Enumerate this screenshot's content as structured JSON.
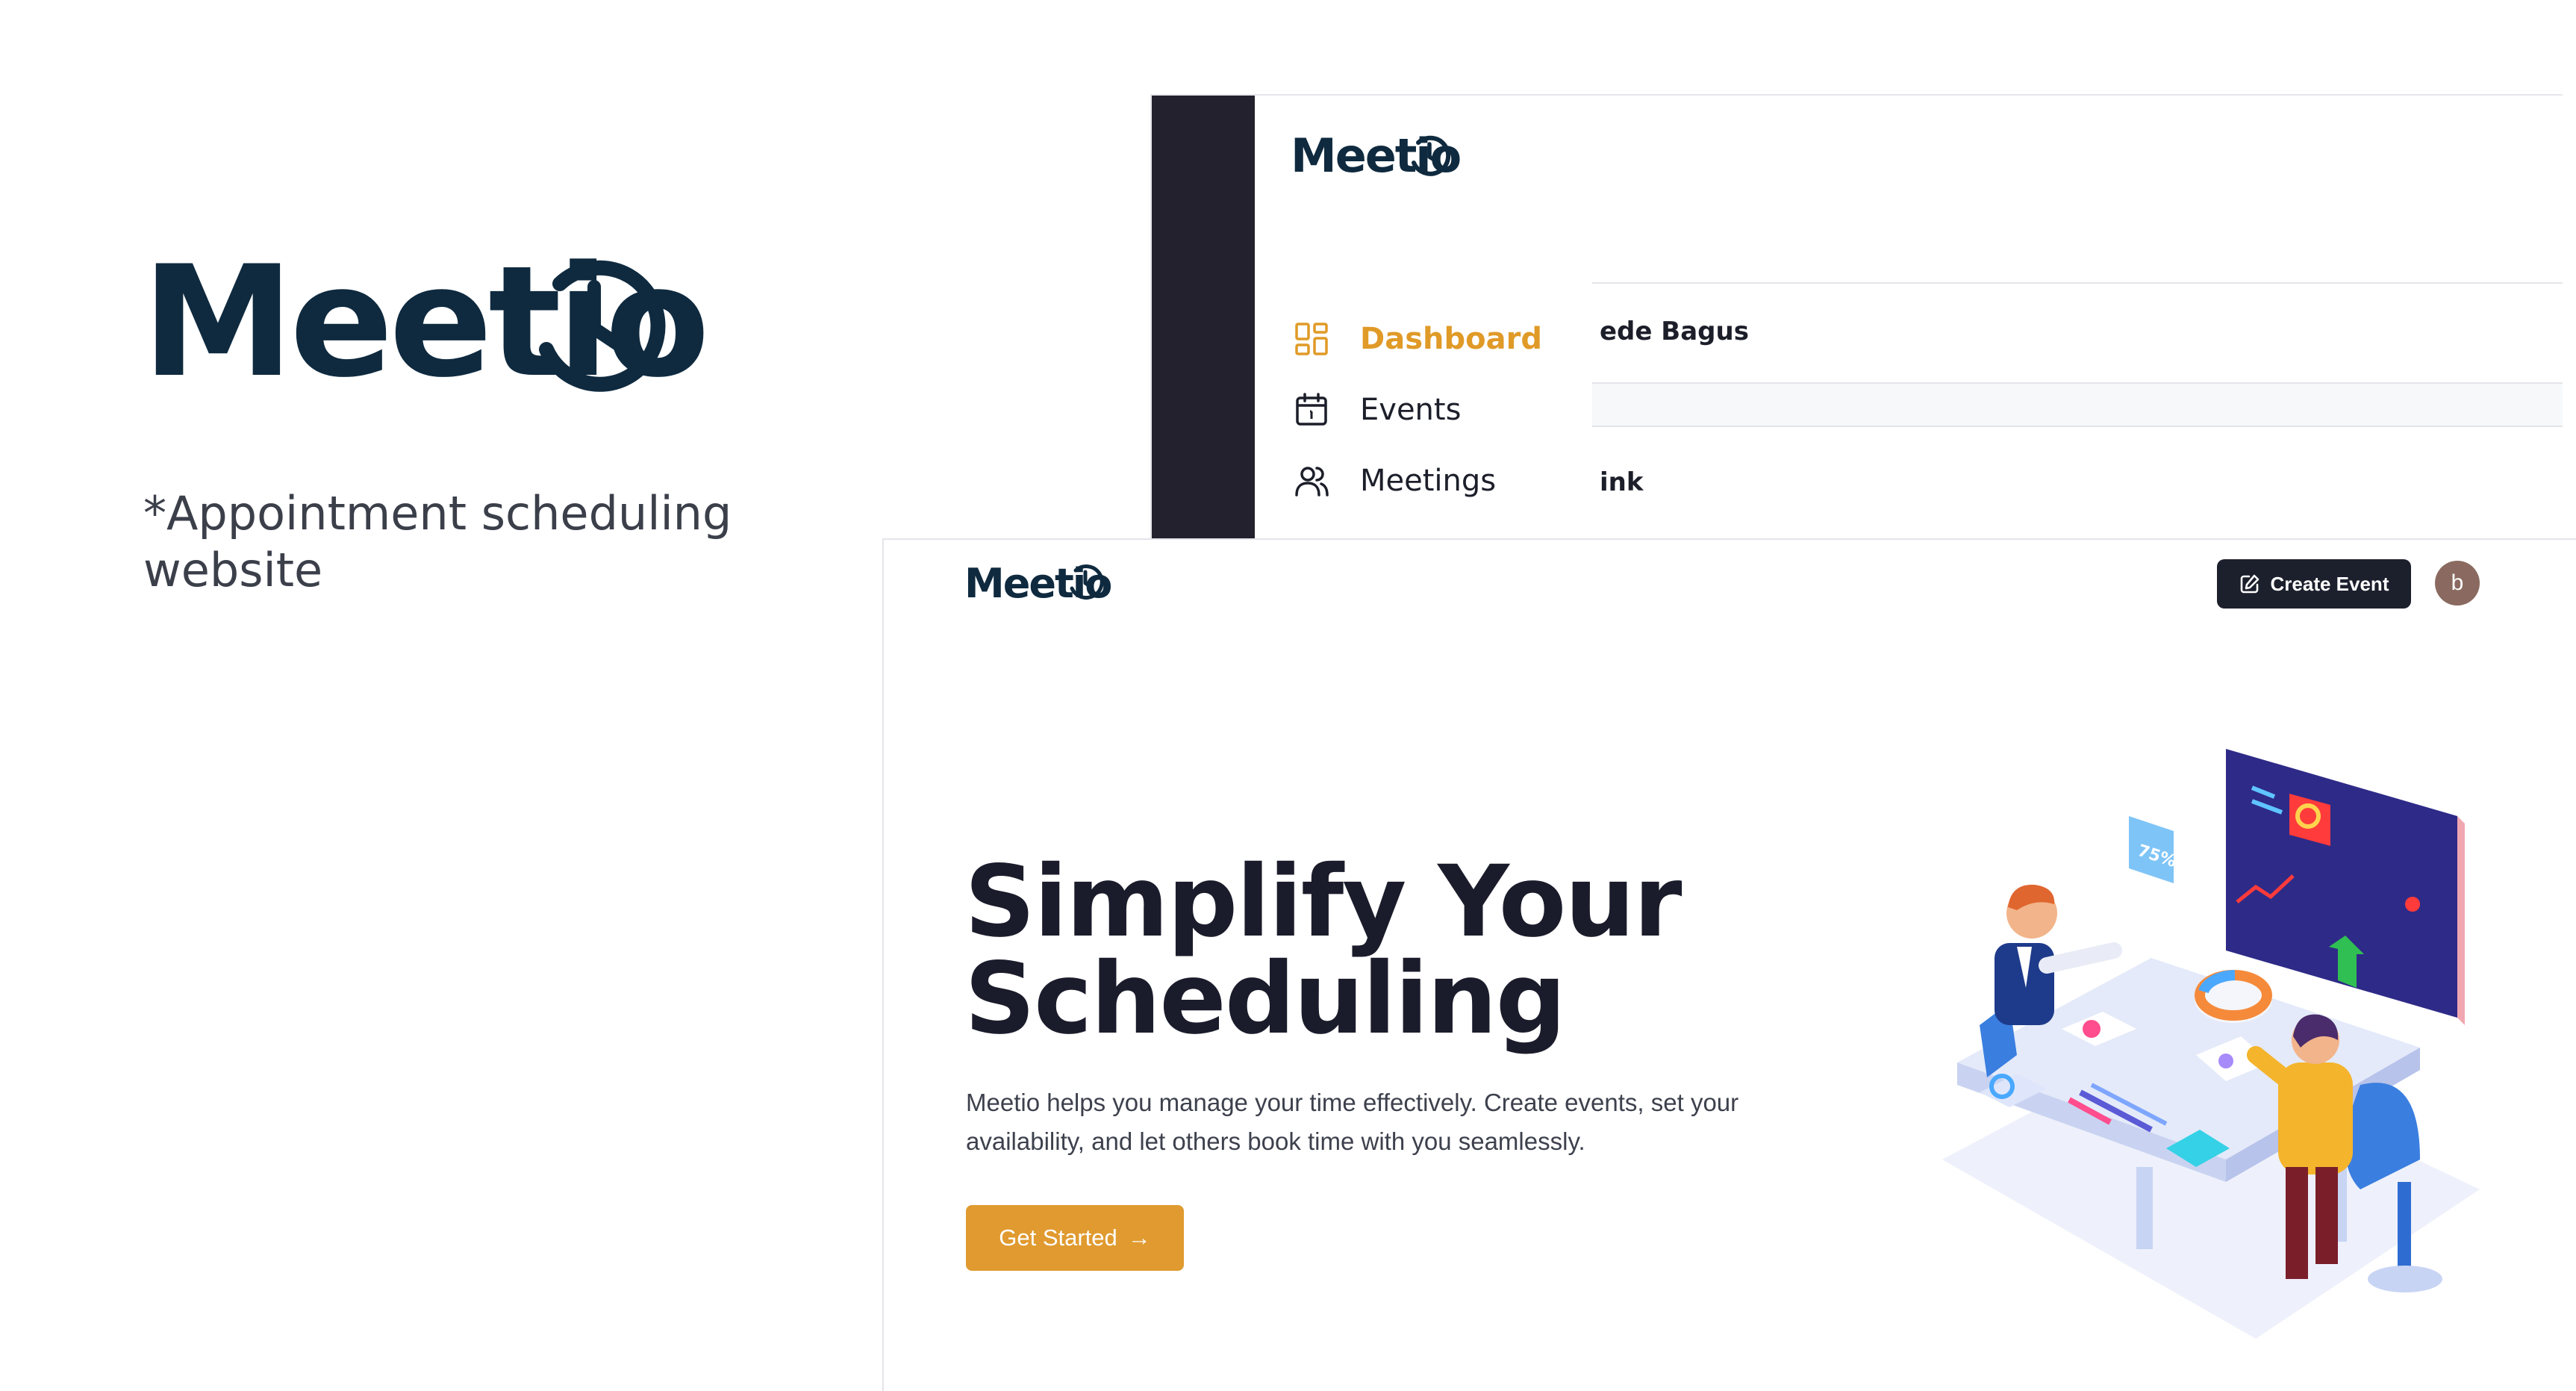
{
  "brand": {
    "logo_text": "Meetio",
    "tagline": "*Appointment scheduling website"
  },
  "dashboard": {
    "logo_text": "Meetio",
    "nav": [
      {
        "label": "Dashboard",
        "icon": "grid-icon",
        "active": true
      },
      {
        "label": "Events",
        "icon": "calendar-icon",
        "active": false
      },
      {
        "label": "Meetings",
        "icon": "users-icon",
        "active": false
      }
    ],
    "rows": [
      {
        "text": "ede Bagus"
      },
      {
        "text": "ink"
      }
    ]
  },
  "landing": {
    "logo_text": "Meetio",
    "create_event_label": "Create Event",
    "avatar_initial": "b",
    "hero_title_line1": "Simplify Your",
    "hero_title_line2": "Scheduling",
    "hero_description": "Meetio helps you manage your time effectively. Create events, set your availability, and let others book time with you seamlessly.",
    "cta_label": "Get Started",
    "cta_arrow": "→",
    "illustration_badge": "75%"
  },
  "colors": {
    "brand_navy": "#0f2a3f",
    "accent_orange": "#e09a2f",
    "dark_button": "#1c1f2c",
    "sidebar_dark": "#22212d"
  }
}
